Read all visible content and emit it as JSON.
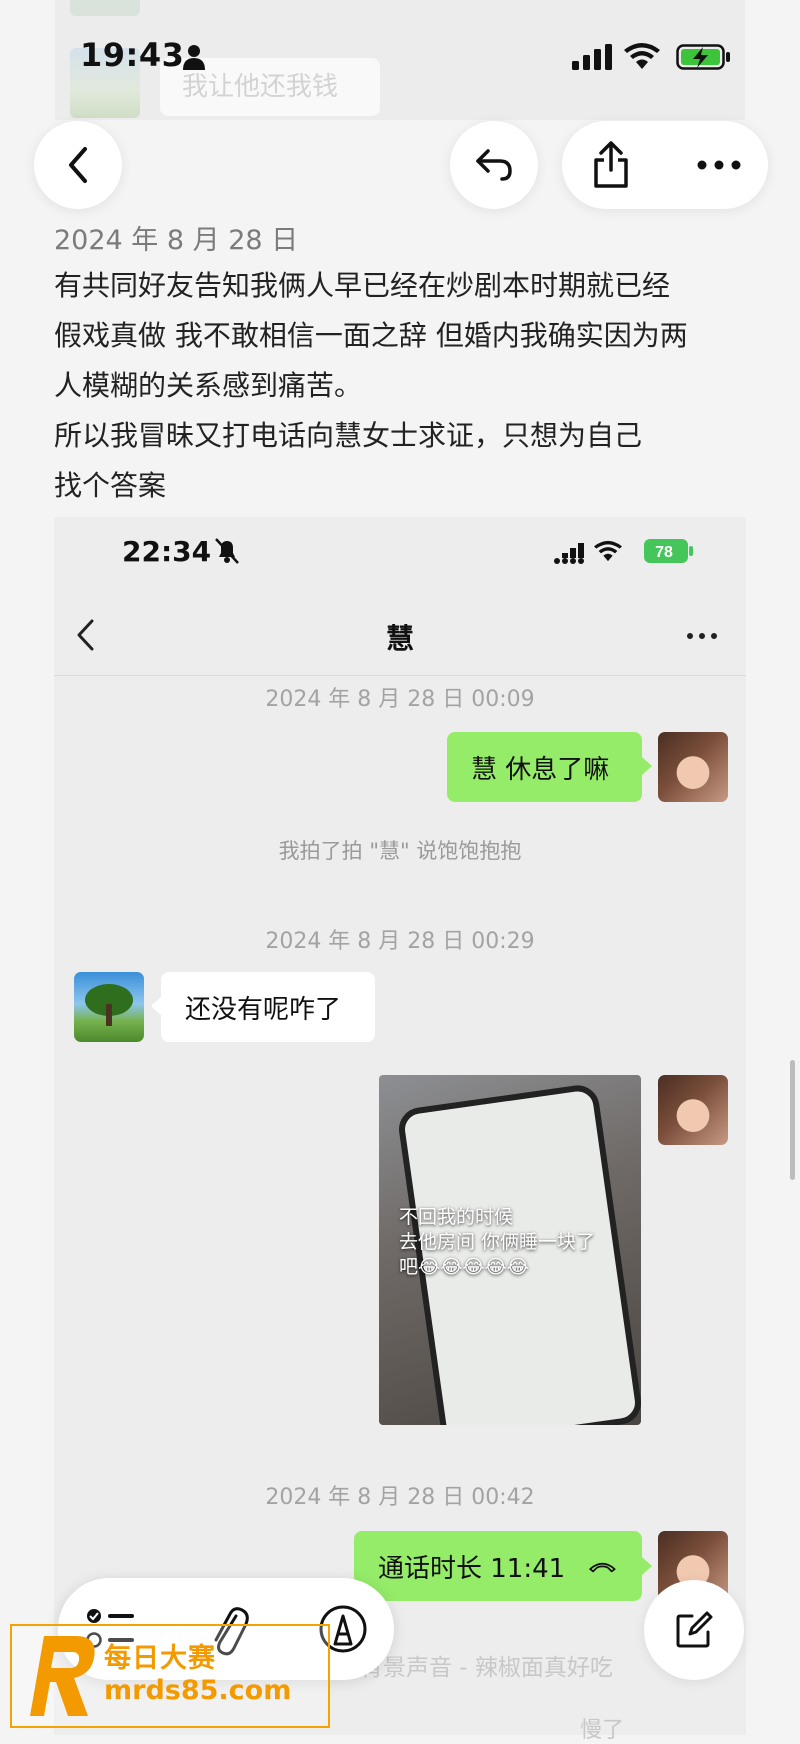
{
  "status_bar": {
    "time": "19:43"
  },
  "background_chat": {
    "faded_message": "我让他还我钱"
  },
  "nav": {
    "back_icon": "chevron-left-icon",
    "reply_icon": "reply-icon",
    "share_icon": "share-icon",
    "more_icon": "more-icon"
  },
  "post": {
    "date": "2024 年 8 月 28 日",
    "lines": [
      "有共同好友告知我俩人早已经在炒剧本时期就已经",
      "假戏真做 我不敢相信一面之辞 但婚内我确实因为两",
      "人模糊的关系感到痛苦。",
      "所以我冒昧又打电话向慧女士求证，只想为自己",
      "找个答案"
    ]
  },
  "screenshot": {
    "status_time": "22:34",
    "battery": "78",
    "chat_title": "慧",
    "timestamps": [
      "2024 年 8 月 28 日 00:09",
      "2024 年 8 月 28 日 00:29",
      "2024 年 8 月 28 日 00:42"
    ],
    "msg1": "慧 休息了嘛",
    "system_msg": "我拍了拍 \"慧\" 说饱饱抱抱",
    "msg2": "还没有呢咋了",
    "photo_text_line1": "不回我的时候",
    "photo_text_line2": "去他房间 你俩睡一块了",
    "photo_text_line3": "吧😂😂😂😂😂",
    "call_msg": "通话时长 11:41",
    "faded_caption": "背景声音 - 辣椒面真好吃",
    "faded_caption2": "慢了"
  },
  "toolbar": {
    "checklist_icon": "checklist-icon",
    "attach_icon": "paperclip-icon",
    "markup_icon": "markup-pen-icon",
    "compose_icon": "compose-icon"
  },
  "watermark": {
    "line1": "每日大赛",
    "line2": "mrds85.com"
  },
  "colors": {
    "green_bubble": "#95ec69",
    "watermark": "#f39a00"
  }
}
